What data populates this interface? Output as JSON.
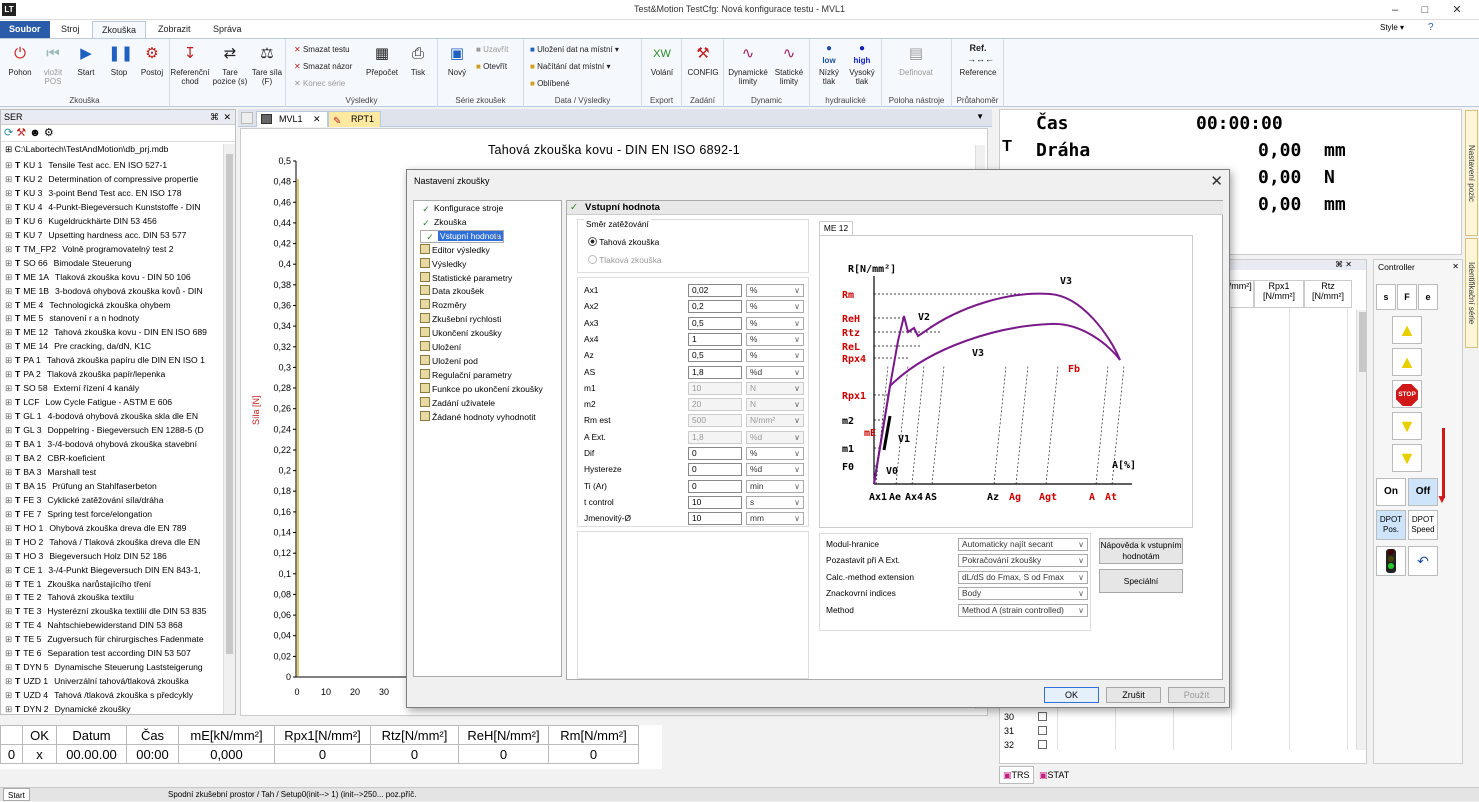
{
  "window": {
    "title": "Test&Motion  TestCfg: Nová konfigurace testu - MVL1",
    "style_label": "Style",
    "logo": "LT"
  },
  "menu_tabs": [
    "Soubor",
    "Stroj",
    "Zkouška",
    "Zobrazit",
    "Správa"
  ],
  "ribbon": {
    "zkouska": {
      "label": "Zkouška",
      "buttons": [
        "Pohon",
        "vložit POS",
        "Start",
        "Stop",
        "Postoj",
        "Referenční chod",
        "Tare pozice (s)",
        "Tare síla (F)"
      ]
    },
    "vysledky": {
      "label": "Výsledky",
      "small": [
        "Smazat testu",
        "Smazat názor",
        "Konec série"
      ],
      "buttons": [
        "Přepočet",
        "Tisk"
      ]
    },
    "serie": {
      "label": "Série zkoušek",
      "buttons": [
        "Nový"
      ],
      "small": [
        "Uzavřít",
        "Otevřít"
      ]
    },
    "data": {
      "label": "Data / Výsledky",
      "small": [
        "Uložení dat na místní",
        "Načítání dat místní",
        "Oblíbené"
      ]
    },
    "export": {
      "label": "Export",
      "buttons": [
        "Volání"
      ]
    },
    "zadani": {
      "label": "Zadání",
      "buttons": [
        "CONFIG"
      ]
    },
    "dynamic": {
      "label": "Dynamic",
      "buttons": [
        "Dynamické limity",
        "Statické limity"
      ]
    },
    "hydraulicke": {
      "label": "hydraulické",
      "buttons": [
        "Nízký tlak",
        "Vysoký tlak"
      ],
      "badges": [
        "low",
        "high"
      ]
    },
    "poloha": {
      "label": "Poloha nástroje",
      "buttons": [
        "Definovat"
      ]
    },
    "prutahomer": {
      "label": "Průtahoměr",
      "buttons": [
        "Reference"
      ],
      "badge": "Ref."
    }
  },
  "left_panel": {
    "title": "SER",
    "path": "C:\\Labortech\\TestAndMotion\\db_prj.mdb",
    "items": [
      {
        "code": "KU 1",
        "name": "Tensile Test acc. EN ISO 527-1"
      },
      {
        "code": "KU 2",
        "name": "Determination of compressive propertie"
      },
      {
        "code": "KU 3",
        "name": "3-point Bend Test acc. EN ISO 178"
      },
      {
        "code": "KU 4",
        "name": "4-Punkt-Biegeversuch Kunststoffe - DIN"
      },
      {
        "code": "KU 6",
        "name": "Kugeldruckhärte DIN 53 456"
      },
      {
        "code": "KU 7",
        "name": "Upsetting hardness acc. DIN 53 577"
      },
      {
        "code": "TM_FP2",
        "name": "Volně programovatelný test 2"
      },
      {
        "code": "SO 66",
        "name": "Bimodale Steuerung"
      },
      {
        "code": "ME 1A",
        "name": "Tlaková zkouška kovu - DIN 50 106"
      },
      {
        "code": "ME 1B",
        "name": "3-bodová ohybová zkouška kovů - DIN"
      },
      {
        "code": "ME 4",
        "name": "Technologická zkouška ohybem"
      },
      {
        "code": "ME 5",
        "name": "stanovení r a n hodnoty"
      },
      {
        "code": "ME 12",
        "name": "Tahová zkouška kovu - DIN EN ISO 689"
      },
      {
        "code": "ME 14",
        "name": "Pre cracking, da/dN, K1C"
      },
      {
        "code": "PA 1",
        "name": "Tahová zkouška papíru dle DIN EN ISO 1"
      },
      {
        "code": "PA 2",
        "name": "Tlaková zkouška papír/lepenka"
      },
      {
        "code": "SO 58",
        "name": "Externí řízení 4 kanály"
      },
      {
        "code": "LCF",
        "name": "Low Cycle Fatigue - ASTM E 606"
      },
      {
        "code": "GL 1",
        "name": "4-bodová ohybová zkouška skla dle EN"
      },
      {
        "code": "GL 3",
        "name": "Doppelring - Biegeversuch EN 1288-5 (D"
      },
      {
        "code": "BA 1",
        "name": "3-/4-bodová ohybová zkouška stavební"
      },
      {
        "code": "BA 2",
        "name": "CBR-koeficient"
      },
      {
        "code": "BA 3",
        "name": "Marshall test"
      },
      {
        "code": "BA 15",
        "name": "Prüfung an Stahlfaserbeton"
      },
      {
        "code": "FE 3",
        "name": "Cyklické zatěžování síla/dráha"
      },
      {
        "code": "FE 7",
        "name": "Spring test force/elongation"
      },
      {
        "code": "HO 1",
        "name": "Ohybová zkouška dreva dle EN 789"
      },
      {
        "code": "HO 2",
        "name": "Tahová / Tlaková zkouška dreva dle EN"
      },
      {
        "code": "HO 3",
        "name": "Biegeversuch Holz  DIN 52 186"
      },
      {
        "code": "CE 1",
        "name": "3-/4-Punkt Biegeversuch DIN EN 843-1,"
      },
      {
        "code": "TE 1",
        "name": "Zkouška narůstajícího tření"
      },
      {
        "code": "TE 2",
        "name": "Tahová zkouška textilu"
      },
      {
        "code": "TE 3",
        "name": "Hysterézní zkouška textilií dle DIN 53 835"
      },
      {
        "code": "TE 4",
        "name": "Nahtschiebewiderstand DIN 53 868"
      },
      {
        "code": "TE 5",
        "name": "Zugversuch für chirurgisches Fadenmate"
      },
      {
        "code": "TE 6",
        "name": "Separation test according DIN 53 507"
      },
      {
        "code": "DYN 5",
        "name": "Dynamische Steuerung Laststeigerung"
      },
      {
        "code": "UZD 1",
        "name": "Univerzální tahová/tlaková zkouška"
      },
      {
        "code": "UZD 4",
        "name": "Tahová /tlaková zkouška s předcykly"
      },
      {
        "code": "DYN 2",
        "name": "Dynamické zkoušky"
      }
    ]
  },
  "doc_tabs": [
    "MVL1",
    "RPT1"
  ],
  "chart": {
    "title": "Tahová zkouška kovu - DIN EN ISO 6892-1",
    "ylabel": "Síla [N]",
    "y_ticks": [
      "0,5",
      "0,48",
      "0,46",
      "0,44",
      "0,42",
      "0,4",
      "0,38",
      "0,36",
      "0,34",
      "0,32",
      "0,3",
      "0,28",
      "0,26",
      "0,24",
      "0,22",
      "0,2",
      "0,18",
      "0,16",
      "0,14",
      "0,12",
      "0,1",
      "0,08",
      "0,06",
      "0,04",
      "0,02",
      "0"
    ],
    "x_ticks": [
      "0",
      "10",
      "20",
      "30"
    ]
  },
  "results_table": {
    "headers": [
      "",
      "OK",
      "Datum",
      "Čas",
      "mE[kN/mm²]",
      "Rpx1[N/mm²]",
      "Rtz[N/mm²]",
      "ReH[N/mm²]",
      "Rm[N/mm²]"
    ],
    "row": [
      "0",
      "x",
      "00.00.00",
      "00:00",
      "0,000",
      "0",
      "0",
      "0",
      "0"
    ]
  },
  "readouts": [
    {
      "label": "Čas",
      "value": "00:00:00",
      "unit": ""
    },
    {
      "label": "Dráha",
      "value": "0,00",
      "unit": "mm"
    },
    {
      "label": "",
      "value": "0,00",
      "unit": "N"
    },
    {
      "label": "",
      "value": "0,00",
      "unit": "mm"
    }
  ],
  "readout_T": "T",
  "right_table": {
    "headers": [
      "mE [/mm²]",
      "Rpx1 [N/mm²]",
      "Rtz [N/mm²]"
    ],
    "row_numbers": [
      "30",
      "31",
      "32"
    ]
  },
  "right_tabs": [
    "TRS",
    "STAT"
  ],
  "side_tabs": [
    "Nastavení pozic",
    "Identifikační série"
  ],
  "controller": {
    "title": "Controller",
    "top": [
      "s",
      "F",
      "e"
    ],
    "on": "On",
    "off": "Off",
    "dpot_pos": "DPOT Pos.",
    "dpot_speed": "DPOT Speed",
    "stop": "STOP"
  },
  "status": {
    "start": "Start",
    "text": "Spodní zkušební prostor / Tah / Setup0(init--> 1)   (init-->250...   poz.příč."
  },
  "dialog": {
    "title": "Nastavení zkoušky",
    "nav": [
      {
        "label": "Konfigurace stroje",
        "icon": "check"
      },
      {
        "label": "Zkouška",
        "icon": "check"
      },
      {
        "label": "Vstupní hodnota",
        "icon": "check",
        "selected": true
      },
      {
        "label": "Editor výsledky",
        "icon": "doc"
      },
      {
        "label": "Výsledky",
        "icon": "doc"
      },
      {
        "label": "Statistické parametry",
        "icon": "doc"
      },
      {
        "label": "Data zkoušek",
        "icon": "doc"
      },
      {
        "label": "Rozměry",
        "icon": "doc"
      },
      {
        "label": "Zkušební rychlosti",
        "icon": "doc"
      },
      {
        "label": "Ukončení zkoušky",
        "icon": "doc"
      },
      {
        "label": "Uložení",
        "icon": "doc"
      },
      {
        "label": "Uložení pod",
        "icon": "doc"
      },
      {
        "label": "Regulační parametry",
        "icon": "doc"
      },
      {
        "label": "Funkce po ukončení zkoušky",
        "icon": "doc"
      },
      {
        "label": "Zadání uživatele",
        "icon": "doc"
      },
      {
        "label": "Žádané hodnoty vyhodnotit",
        "icon": "doc"
      }
    ],
    "panel_title": "Vstupní hodnota",
    "direction_label": "Směr zatěžování",
    "radio_tension": "Tahová zkouška",
    "radio_compression": "Tlaková zkouška",
    "params": [
      {
        "name": "Ax1",
        "value": "0,02",
        "unit": "%",
        "disabled": false
      },
      {
        "name": "Ax2",
        "value": "0,2",
        "unit": "%",
        "disabled": false
      },
      {
        "name": "Ax3",
        "value": "0,5",
        "unit": "%",
        "disabled": false
      },
      {
        "name": "Ax4",
        "value": "1",
        "unit": "%",
        "disabled": false
      },
      {
        "name": "Az",
        "value": "0,5",
        "unit": "%",
        "disabled": false
      },
      {
        "name": "AS",
        "value": "1,8",
        "unit": "%d",
        "disabled": false
      },
      {
        "name": "m1",
        "value": "10",
        "unit": "N",
        "disabled": true
      },
      {
        "name": "m2",
        "value": "20",
        "unit": "N",
        "disabled": true
      },
      {
        "name": "Rm est",
        "value": "500",
        "unit": "N/mm²",
        "disabled": true
      },
      {
        "name": "A Ext.",
        "value": "1,8",
        "unit": "%d",
        "disabled": true
      },
      {
        "name": "Dif",
        "value": "0",
        "unit": "%",
        "disabled": false
      },
      {
        "name": "Hystereze",
        "value": "0",
        "unit": "%d",
        "disabled": false
      },
      {
        "name": "Ti (Ar)",
        "value": "0",
        "unit": "min",
        "disabled": false
      },
      {
        "name": "t control",
        "value": "10",
        "unit": "s",
        "disabled": false
      },
      {
        "name": "Jmenovitý-Ø",
        "value": "10",
        "unit": "mm",
        "disabled": false
      }
    ],
    "image_tab": "ME 12",
    "diagram_labels": {
      "ylabel": "R[N/mm²]",
      "xlabel": "A[%]",
      "y": [
        "Rm",
        "ReH",
        "Rtz",
        "ReL",
        "Rpx4",
        "Rpx1",
        "m2",
        "m1",
        "F0"
      ],
      "mE": "mE",
      "x": [
        "Ax1",
        "Ae",
        "Ax4",
        "AS",
        "Az",
        "Ag",
        "Agt",
        "A",
        "At"
      ],
      "curves": [
        "V3",
        "V2",
        "V3",
        "V1",
        "V0",
        "Fb"
      ]
    },
    "options": [
      {
        "label": "Modul-hranice",
        "value": "Automaticky najít secant"
      },
      {
        "label": "Pozastavit při A Ext.",
        "value": "Pokračování zkoušky"
      },
      {
        "label": "Calc.-method extension",
        "value": "dL/dS do Fmax, S od Fmax"
      },
      {
        "label": "Znackovrní indices",
        "value": "Body"
      },
      {
        "label": "Method",
        "value": "Method A (strain controlled)"
      }
    ],
    "help_button": "Nápověda k vstupním hodnotám",
    "special_button": "Speciální",
    "ok": "OK",
    "cancel": "Zrušit",
    "apply": "Použít"
  },
  "colors": {
    "accent": "#2a5caa",
    "diagram_red": "#cc0000",
    "diagram_curve": "#7a1a8a"
  }
}
